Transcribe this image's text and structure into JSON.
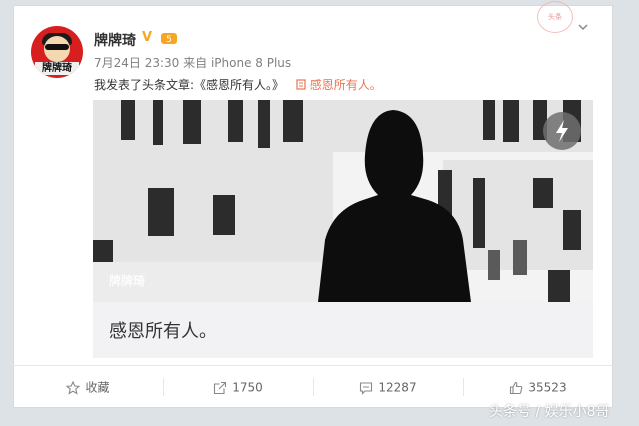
{
  "post": {
    "author_name": "牌牌琦",
    "verified_badge": "V",
    "level_badge": "5",
    "timestamp": "7月24日 23:30",
    "source": "来自 iPhone 8 Plus",
    "text": "我发表了头条文章:《感恩所有人。》",
    "link_icon": "article-icon",
    "link_text": "感恩所有人。",
    "avatar_text": "牌牌琦",
    "image_watermark": "牌牌琦",
    "article_title": "感恩所有人。",
    "stamp_text": "头条"
  },
  "actions": {
    "favorite_label": "收藏",
    "repost_count": "1750",
    "comment_count": "12287",
    "like_count": "35523"
  },
  "footer": {
    "credit": "头条号 / 娱乐小8哥"
  },
  "colors": {
    "link": "#eb7350",
    "badge_orange": "#f6a623",
    "avatar_red": "#d71f1f"
  }
}
